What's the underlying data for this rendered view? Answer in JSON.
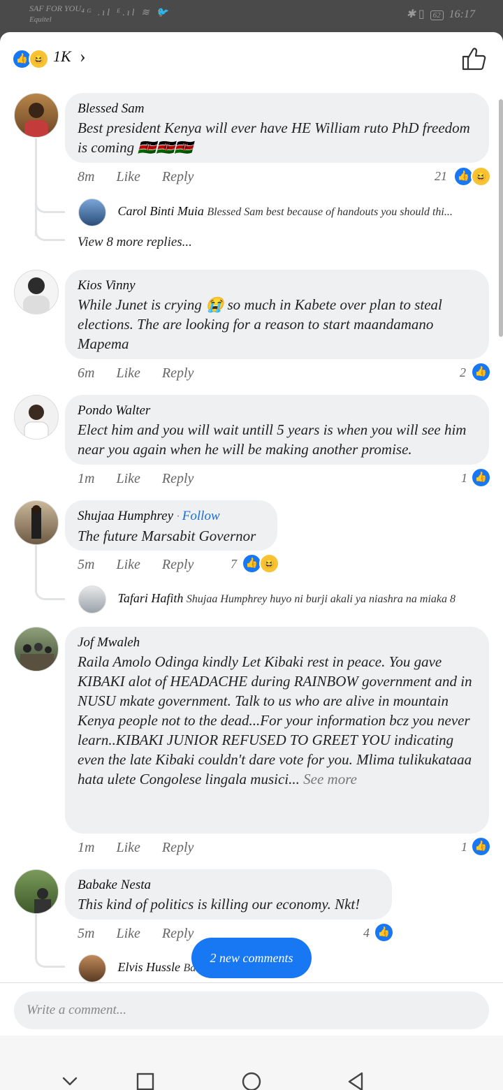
{
  "status_bar": {
    "carrier_line1": "SAF FOR YOU",
    "carrier_line2": "Equitel",
    "signal_icons": "⁴ᴳ .ıl ᴱ.ıl ≋ 🐦",
    "battery": "62",
    "time": "16:17"
  },
  "header": {
    "reaction_count": "1K"
  },
  "comments": [
    {
      "author": "Blessed Sam",
      "text": "Best president Kenya will ever have HE William ruto PhD freedom is coming 🇰🇪🇰🇪🇰🇪",
      "time": "8m",
      "like_label": "Like",
      "reply_label": "Reply",
      "reaction_count": "21",
      "reply": {
        "name": "Carol Binti Muia",
        "text": "Blessed Sam best because of handouts you should thi..."
      },
      "more_replies": "View 8 more replies..."
    },
    {
      "author": "Kios Vinny",
      "text": "While Junet is crying 😭 so much in Kabete over plan to steal elections. The are looking for a reason to start maandamano Mapema",
      "time": "6m",
      "like_label": "Like",
      "reply_label": "Reply",
      "reaction_count": "2"
    },
    {
      "author": "Pondo Walter",
      "text": "Elect him and you will wait untill 5 years is when you will see him near you again when he will be making another promise.",
      "time": "1m",
      "like_label": "Like",
      "reply_label": "Reply",
      "reaction_count": "1"
    },
    {
      "author": "Shujaa Humphrey",
      "follow": "Follow",
      "text": "The future Marsabit Governor",
      "time": "5m",
      "like_label": "Like",
      "reply_label": "Reply",
      "reaction_count": "7",
      "reply": {
        "name": "Tafari Hafith",
        "text": "Shujaa Humphrey huyo ni burji akali ya niashra na miaka  8"
      }
    },
    {
      "author": "Jof Mwaleh",
      "text": "Raila Amolo Odinga kindly Let Kibaki rest in peace. You gave KIBAKI alot of HEADACHE during RAINBOW government and in NUSU mkate government. Talk to us who are alive in mountain Kenya people not to the dead...For your information bcz you never learn..KIBAKI JUNIOR REFUSED TO GREET YOU indicating even the late Kibaki couldn't dare vote for you. Mlima tulikukataaa hata ulete Congolese lingala musici...",
      "see_more": "See more",
      "time": "1m",
      "like_label": "Like",
      "reply_label": "Reply",
      "reaction_count": "1"
    },
    {
      "author": "Babake Nesta",
      "text": "This kind of politics is killing our economy. Nkt!",
      "time": "5m",
      "like_label": "Like",
      "reply_label": "Reply",
      "reaction_count": "4",
      "reply": {
        "name": "Elvis Hussle",
        "text": "Ba"
      }
    }
  ],
  "new_comments_toast": "2 new comments",
  "composer": {
    "placeholder": "Write a comment..."
  },
  "colors": {
    "accent": "#1877f2",
    "bubble": "#eff0f2"
  }
}
